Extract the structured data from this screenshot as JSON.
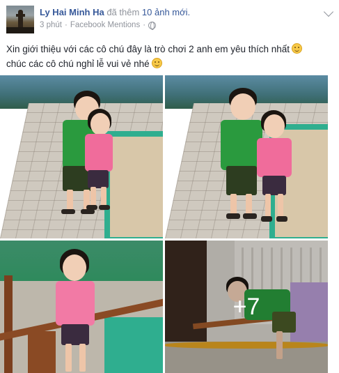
{
  "post": {
    "author_name": "Ly Hai Minh Ha",
    "action_text": " đã thêm ",
    "action_count": "10 ảnh mới.",
    "time": "3 phút",
    "separator": " · ",
    "source": "Facebook Mentions",
    "separator2": " · ",
    "privacy_icon": "globe-icon",
    "message_line1": "Xin giới thiệu với các cô chú đây là trò chơi 2 anh em yêu thích nhất",
    "message_line2": "chúc các cô chú nghỉ lễ vui vẻ nhé",
    "emoji": "smile-emoji"
  },
  "photos": {
    "more_count": "+7"
  },
  "colors": {
    "link": "#365899",
    "meta": "#90949c",
    "text": "#1d2129"
  }
}
